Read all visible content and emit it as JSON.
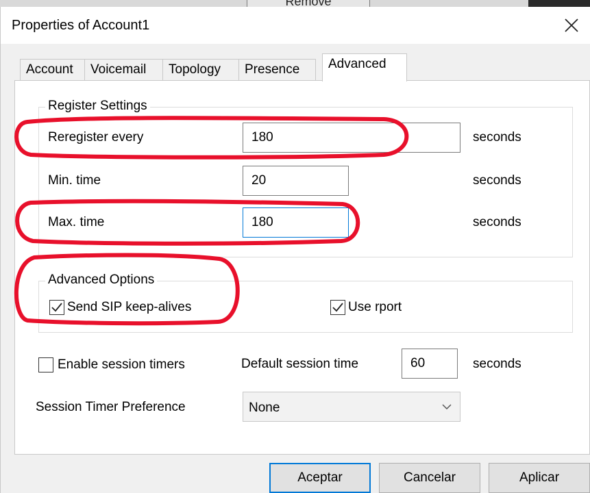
{
  "background": {
    "remove_label": "Remove"
  },
  "window": {
    "title": "Properties of Account1"
  },
  "tabs": [
    {
      "label": "Account"
    },
    {
      "label": "Voicemail"
    },
    {
      "label": "Topology"
    },
    {
      "label": "Presence"
    },
    {
      "label": "Advanced"
    }
  ],
  "register_settings": {
    "title": "Register Settings",
    "reregister": {
      "label": "Reregister every",
      "value": "180",
      "unit": "seconds"
    },
    "min_time": {
      "label": "Min. time",
      "value": "20",
      "unit": "seconds"
    },
    "max_time": {
      "label": "Max. time",
      "value": "180",
      "unit": "seconds"
    }
  },
  "advanced_options": {
    "title": "Advanced Options",
    "send_keepalives": {
      "label": "Send SIP keep-alives",
      "checked": true
    },
    "use_rport": {
      "label": "Use rport",
      "checked": true
    }
  },
  "session": {
    "enable_timers": {
      "label": "Enable session timers",
      "checked": false
    },
    "default_time": {
      "label": "Default session time",
      "value": "60",
      "unit": "seconds"
    },
    "preference": {
      "label": "Session Timer Preference",
      "selected": "None"
    }
  },
  "buttons": {
    "ok": "Aceptar",
    "cancel": "Cancelar",
    "apply": "Aplicar"
  },
  "colors": {
    "annotation": "#e8102b",
    "focus": "#0078d7"
  }
}
